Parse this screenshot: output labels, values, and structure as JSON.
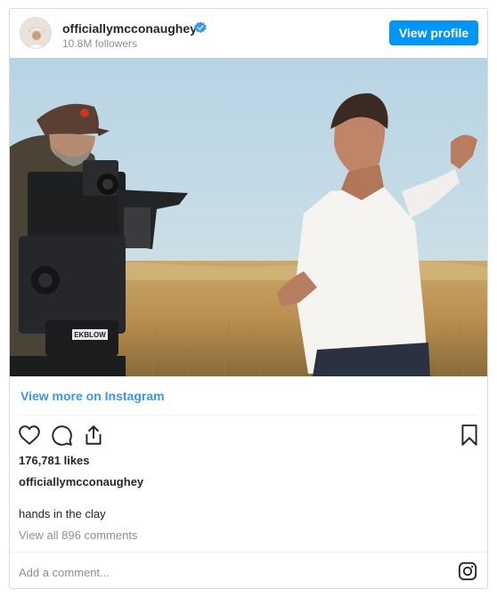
{
  "header": {
    "username": "officiallymcconaughey",
    "followers": "10.8M followers",
    "view_profile_label": "View profile",
    "verified_icon": "verified-badge-icon"
  },
  "post": {
    "view_more_label": "View more on Instagram",
    "likes": "176,781 likes",
    "caption_username": "officiallymcconaughey",
    "caption_text": "hands in the clay",
    "view_comments": "View all 896 comments",
    "camera_brand": "EKBLOW"
  },
  "actions": {
    "like_icon": "heart-icon",
    "comment_icon": "comment-icon",
    "share_icon": "share-icon",
    "save_icon": "bookmark-icon"
  },
  "comment": {
    "placeholder": "Add a comment..."
  },
  "colors": {
    "accent": "#0095f6",
    "link": "#3897f0",
    "muted": "#8e8e8e",
    "border": "#dbdbdb"
  }
}
